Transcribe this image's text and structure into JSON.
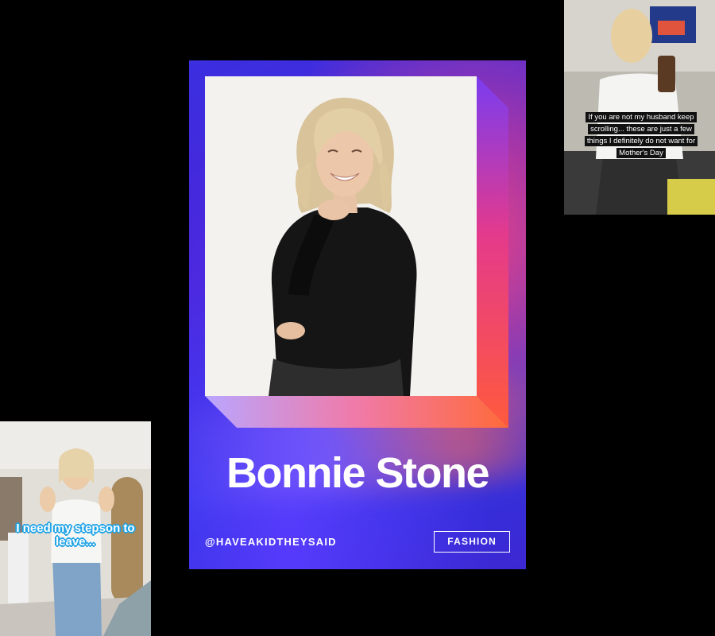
{
  "card": {
    "name": "Bonnie Stone",
    "handle": "@HAVEAKIDTHEYSAID",
    "category": "FASHION"
  },
  "thumbnails": {
    "right": {
      "caption": "If you are not my husband keep scrolling... these are just a few things I definitely do not want for Mother's Day"
    },
    "left": {
      "caption": "I need my stepson to leave..."
    }
  },
  "colors": {
    "card_primary": "#3b2fe0",
    "card_accent": "#ff4678",
    "caption_blue": "#1fa3e6"
  }
}
